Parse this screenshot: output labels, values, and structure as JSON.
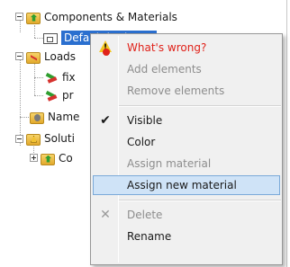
{
  "tree": {
    "nodes": [
      {
        "label": "Components & Materials"
      },
      {
        "label": "Default body set"
      },
      {
        "label": "Loads"
      },
      {
        "label": "fix"
      },
      {
        "label": "pr"
      },
      {
        "label": "Name"
      },
      {
        "label": "Soluti"
      },
      {
        "label": "Co"
      }
    ]
  },
  "menu": {
    "items": [
      {
        "label": "What's wrong?",
        "state": "danger",
        "icon": "warning-icon"
      },
      {
        "label": "Add elements",
        "state": "disabled"
      },
      {
        "label": "Remove elements",
        "state": "disabled"
      },
      {
        "label": "Visible",
        "state": "checked",
        "icon": "checkmark-icon"
      },
      {
        "label": "Color",
        "state": "normal"
      },
      {
        "label": "Assign material",
        "state": "disabled"
      },
      {
        "label": "Assign new material",
        "state": "hover"
      },
      {
        "label": "Delete",
        "state": "disabled",
        "icon": "delete-x-icon"
      },
      {
        "label": "Rename",
        "state": "normal"
      }
    ],
    "check_glyph": "✔",
    "delete_glyph": "✕"
  },
  "colors": {
    "selection": "#2a6fcf",
    "danger_text": "#e0221a",
    "hover_bg": "#cfe3f7"
  }
}
